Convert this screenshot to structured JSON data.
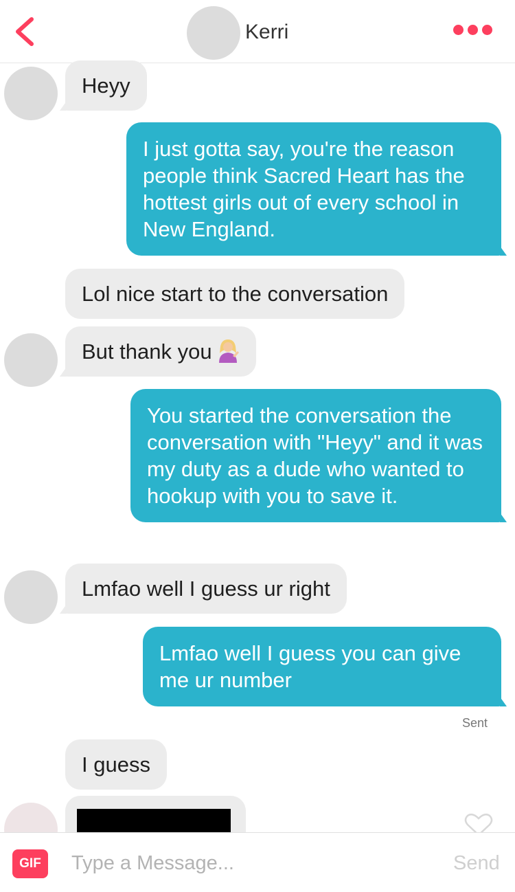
{
  "header": {
    "contact_name": "Kerri",
    "back_icon": "chevron-left-icon",
    "more_icon": "ellipsis-icon",
    "accent_color": "#fd3f5e"
  },
  "messages": [
    {
      "from": "them",
      "text": "Heyy"
    },
    {
      "from": "me",
      "text": "I just gotta say, you're the reason people think Sacred Heart has the hottest girls out of every school in New England."
    },
    {
      "from": "them",
      "text": "Lol nice start to the conversation"
    },
    {
      "from": "them",
      "text": "But thank you",
      "emoji": "woman-tipping-hand-emoji"
    },
    {
      "from": "me",
      "text": "You started the conversation the conversation with \"Heyy\" and it was my duty as a dude who wanted to hookup with you to save it."
    },
    {
      "from": "them",
      "text": "Lmfao well I guess ur right"
    },
    {
      "from": "me",
      "text": "Lmfao well I guess you can give me ur number"
    },
    {
      "from": "them",
      "text": "I guess"
    },
    {
      "from": "them",
      "text": "",
      "redacted": true
    }
  ],
  "status": {
    "sent": "Sent"
  },
  "colors": {
    "outgoing_bubble": "#2bb3cc",
    "incoming_bubble": "#ececec"
  },
  "footer": {
    "gif_label": "GIF",
    "input_placeholder": "Type a Message...",
    "send_label": "Send"
  }
}
